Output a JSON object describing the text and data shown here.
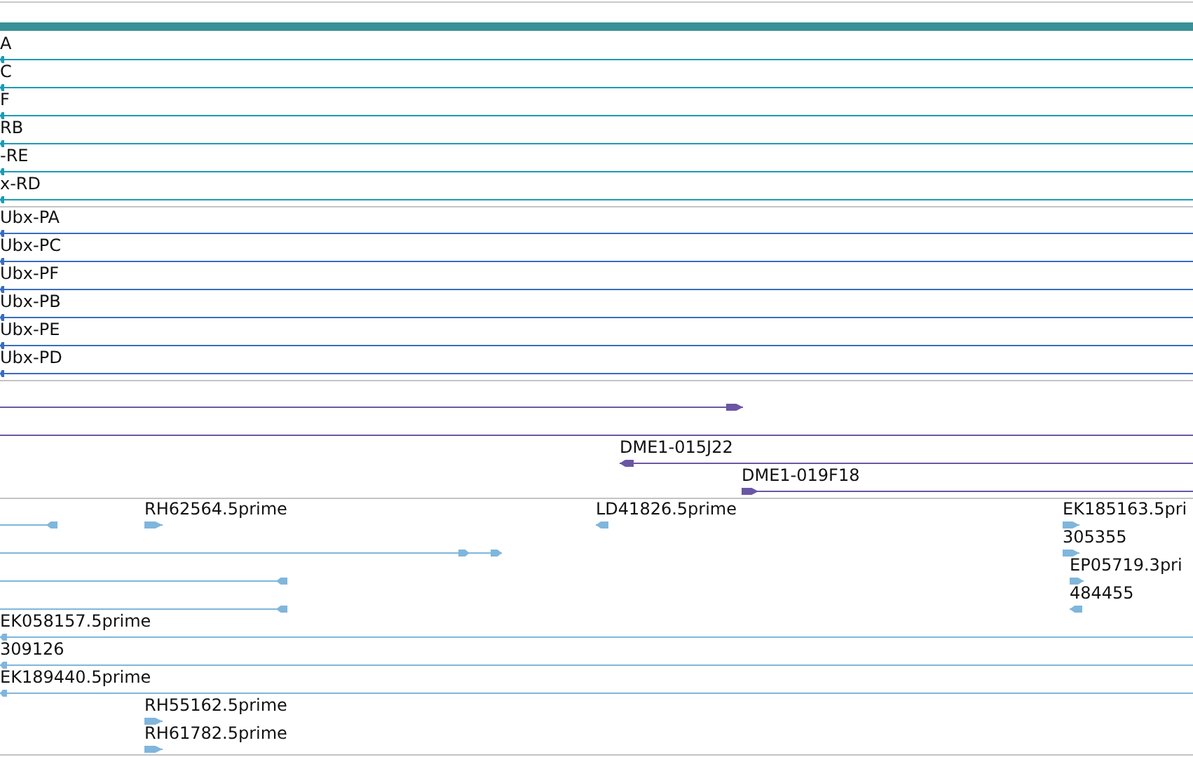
{
  "tracks": [
    {
      "color": "#1e9ab4",
      "features": [
        {
          "label": "A",
          "kind": "reverse"
        },
        {
          "label": "C",
          "kind": "reverse"
        },
        {
          "label": "F",
          "kind": "reverse"
        },
        {
          "label": "RB",
          "kind": "reverse"
        },
        {
          "label": "-RE",
          "kind": "reverse"
        },
        {
          "label": "x-RD",
          "kind": "reverse"
        }
      ]
    },
    {
      "color": "#3a6cc0",
      "features": [
        {
          "label": "Ubx-PA",
          "kind": "reverse"
        },
        {
          "label": "Ubx-PC",
          "kind": "reverse"
        },
        {
          "label": "Ubx-PF",
          "kind": "reverse"
        },
        {
          "label": "Ubx-PB",
          "kind": "reverse"
        },
        {
          "label": "Ubx-PE",
          "kind": "reverse"
        },
        {
          "label": "Ubx-PD",
          "kind": "reverse"
        }
      ]
    },
    {
      "color": "#6a56a4",
      "features": [
        {
          "kind": "forward"
        },
        {
          "kind": "plain"
        },
        {
          "label": "DME1-015J22",
          "kind": "reverse"
        },
        {
          "label": "DME1-019F18",
          "kind": "forward"
        }
      ]
    },
    {
      "color": "#80b6dc",
      "features": [
        {
          "kind": "reverse"
        },
        {
          "label": "RH62564.5prime",
          "kind": "forward"
        },
        {
          "label": "LD41826.5prime",
          "kind": "reverse"
        },
        {
          "label": "EK185163.5pri",
          "kind": "forward"
        },
        {
          "kind": "forward"
        },
        {
          "label": "305355",
          "kind": "forward"
        },
        {
          "kind": "reverse"
        },
        {
          "label": "EP05719.3pri",
          "kind": "forward"
        },
        {
          "kind": "reverse"
        },
        {
          "label": "484455",
          "kind": "reverse"
        },
        {
          "label": "EK058157.5prime",
          "kind": "reverse"
        },
        {
          "label": "309126",
          "kind": "reverse"
        },
        {
          "label": "EK189440.5prime",
          "kind": "reverse"
        },
        {
          "label": "RH55162.5prime",
          "kind": "forward"
        },
        {
          "label": "RH61782.5prime",
          "kind": "forward"
        }
      ]
    }
  ]
}
